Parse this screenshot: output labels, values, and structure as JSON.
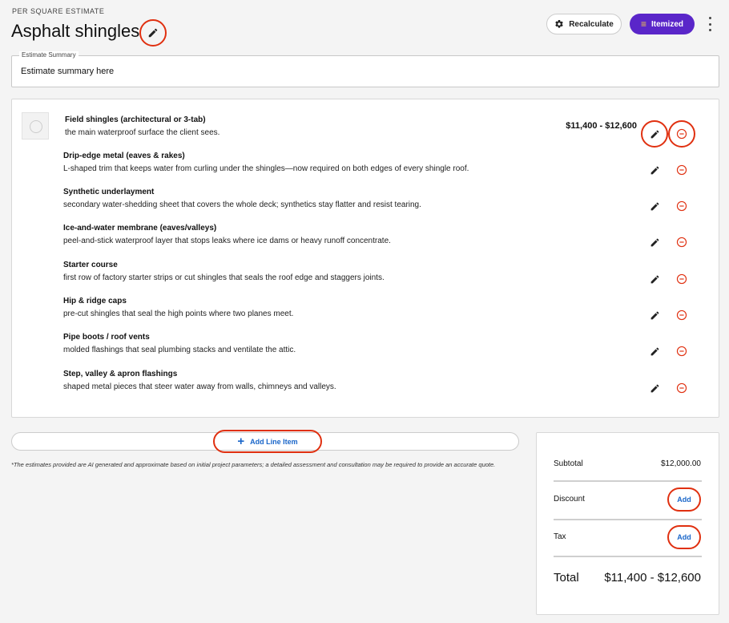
{
  "header": {
    "eyebrow": "PER SQUARE ESTIMATE",
    "title": "Asphalt shingles",
    "recalculate_label": "Recalculate",
    "itemized_label": "Itemized"
  },
  "summary": {
    "label": "Estimate Summary",
    "text": "Estimate summary here"
  },
  "line_items": [
    {
      "name": "Field shingles (architectural or 3-tab)",
      "desc": "the main waterproof surface the client sees.",
      "price": "$11,400 - $12,600"
    },
    {
      "name": "Drip-edge metal (eaves & rakes)",
      "desc": "L-shaped trim that keeps water from curling under the shingles—now required on both edges of every shingle roof."
    },
    {
      "name": "Synthetic underlayment",
      "desc": "secondary water-shedding sheet that covers the whole deck; synthetics stay flatter and resist tearing."
    },
    {
      "name": "Ice-and-water membrane (eaves/valleys)",
      "desc": "peel-and-stick waterproof layer that stops leaks where ice dams or heavy runoff concentrate."
    },
    {
      "name": "Starter course",
      "desc": "first row of factory starter strips or cut shingles that seals the roof edge and staggers joints."
    },
    {
      "name": "Hip & ridge caps",
      "desc": "pre-cut shingles that seal the high points where two planes meet."
    },
    {
      "name": "Pipe boots / roof vents",
      "desc": "molded flashings that seal plumbing stacks and ventilate the attic."
    },
    {
      "name": "Step, valley & apron flashings",
      "desc": "shaped metal pieces that steer water away from walls, chimneys and valleys."
    }
  ],
  "add_line_label": "Add Line Item",
  "disclaimer": "*The estimates provided are AI generated and approximate based on initial project parameters; a detailed assessment and consultation may be required to provide an accurate quote.",
  "totals": {
    "subtotal_label": "Subtotal",
    "subtotal_value": "$12,000.00",
    "discount_label": "Discount",
    "discount_action": "Add",
    "tax_label": "Tax",
    "tax_action": "Add",
    "total_label": "Total",
    "total_value": "$11,400 - $12,600"
  },
  "colors": {
    "accent": "#5a26c9",
    "link": "#1a66c9",
    "remove": "#e03010",
    "highlight_ring": "#e03010"
  }
}
